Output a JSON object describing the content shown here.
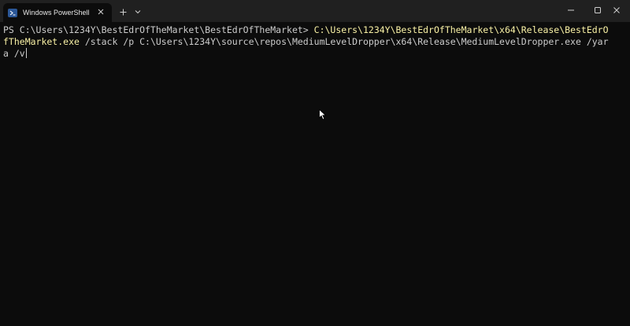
{
  "window": {
    "tab_title": "Windows PowerShell",
    "tab_icon": "powershell-icon",
    "controls": {
      "new_tab_icon": "plus-icon",
      "dropdown_icon": "chevron-down-icon",
      "minimize_icon": "minimize-icon",
      "maximize_icon": "maximize-icon",
      "close_icon": "close-icon"
    }
  },
  "terminal": {
    "line1_prompt": "PS C:\\Users\\1234Y\\BestEdrOfTheMarket\\BestEdrOfTheMarket> ",
    "line1_exe": "C:\\Users\\1234Y\\BestEdrOfTheMarket\\x64\\Release\\BestEdrO",
    "line2_exe": "fTheMarket.exe",
    "line2_args": " /stack /p C:\\Users\\1234Y\\source\\repos\\MediumLevelDropper\\x64\\Release\\MediumLevelDropper.exe /yar",
    "line3_args": "a /v"
  },
  "colors": {
    "background": "#0c0c0c",
    "titlebar": "#202020",
    "text": "#cccccc",
    "executable": "#f9f1a5",
    "tab_icon": "#2b5797"
  }
}
